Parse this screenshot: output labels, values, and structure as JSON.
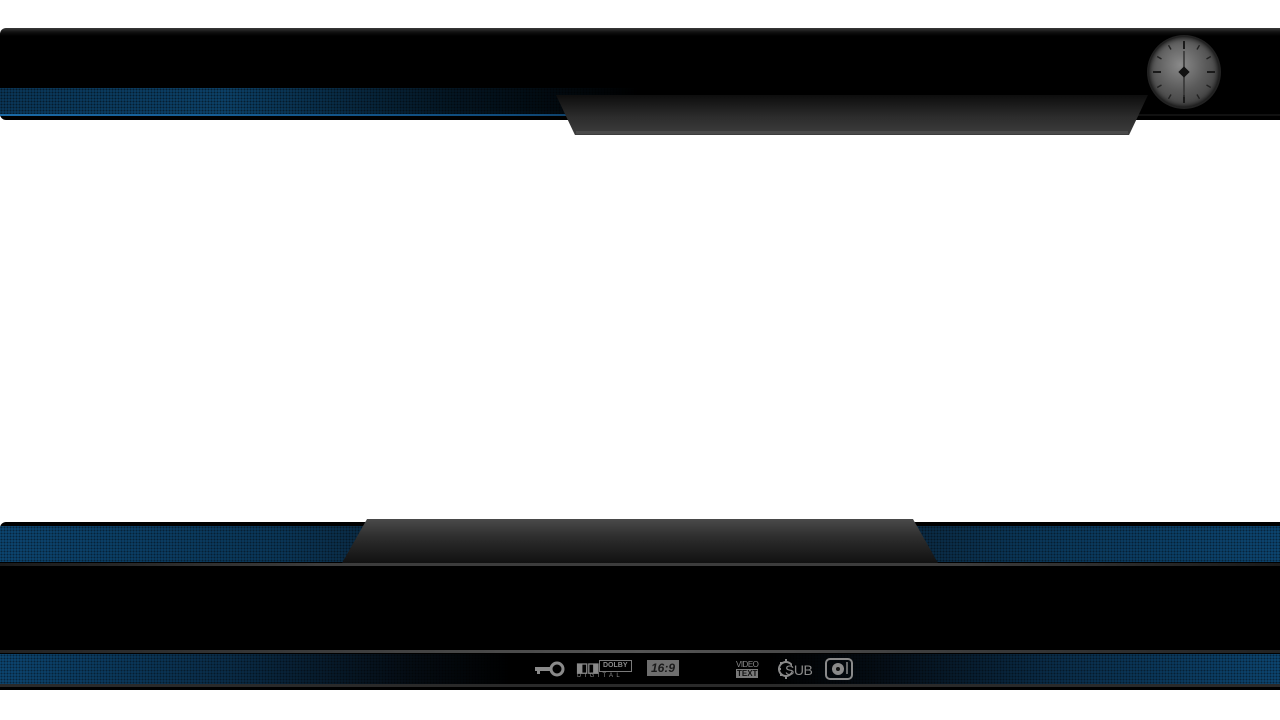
{
  "screen": {
    "type": "media-player-osd-skin",
    "accent_color": "#0d4a78",
    "frame_color": "#000000"
  },
  "top_bar": {
    "clock_icon": "analog-clock-icon"
  },
  "status_icons": {
    "key": {
      "icon": "key-icon"
    },
    "dolby": {
      "icon": "dolby-digital-icon",
      "box_label": "DOLBY",
      "sub_label": "DIGITAL"
    },
    "aspect": {
      "icon": "aspect-ratio-icon",
      "label": "16:9"
    },
    "videotext": {
      "icon": "videotext-icon",
      "line1": "VIDEO",
      "line2": "TEXT"
    },
    "subtitles": {
      "icon": "subtitles-icon",
      "label": "SUB"
    },
    "disc": {
      "icon": "audio-disc-icon"
    }
  }
}
